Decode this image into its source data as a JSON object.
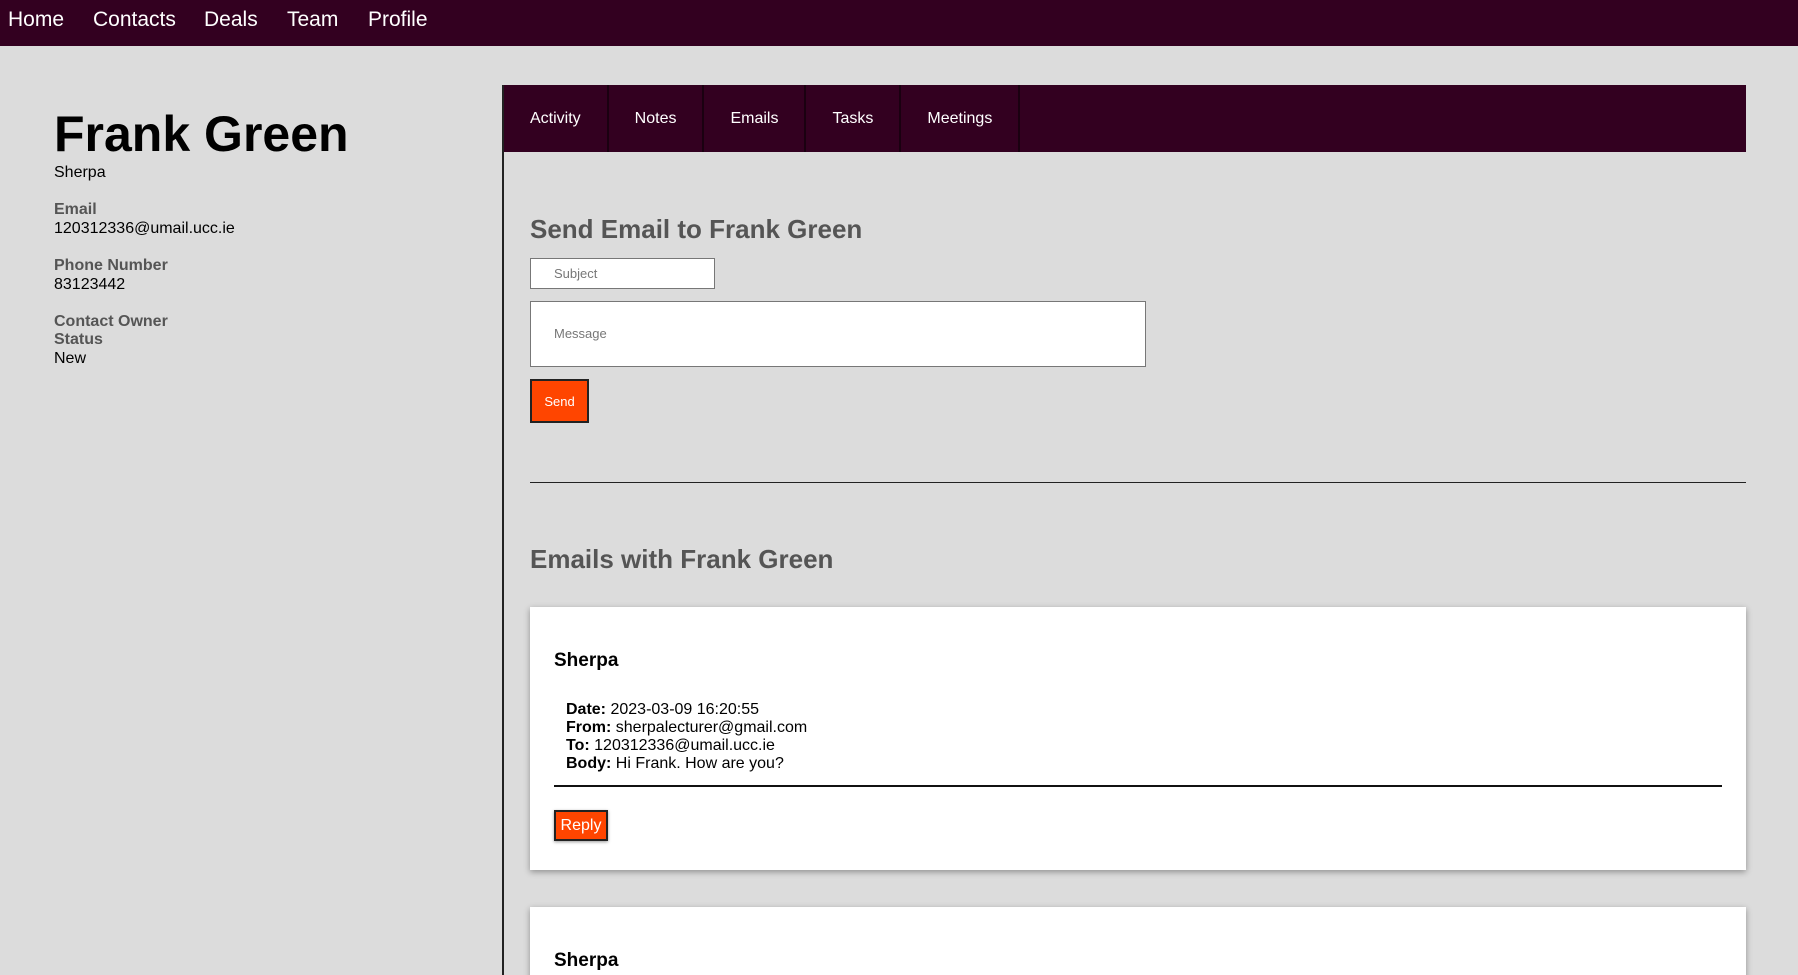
{
  "nav": {
    "items": [
      "Home",
      "Contacts",
      "Deals",
      "Team",
      "Profile"
    ]
  },
  "contact": {
    "name": "Frank Green",
    "company": "Sherpa",
    "fields": [
      {
        "label": "Email",
        "value": "120312336@umail.ucc.ie"
      },
      {
        "label": "Phone Number",
        "value": "83123442"
      },
      {
        "label": "Contact Owner",
        "value": ""
      },
      {
        "label": "Status",
        "value": "New"
      }
    ]
  },
  "tabs": [
    "Activity",
    "Notes",
    "Emails",
    "Tasks",
    "Meetings"
  ],
  "send_form": {
    "title": "Send Email to Frank Green",
    "subject_placeholder": "Subject",
    "message_placeholder": "Message",
    "send_label": "Send"
  },
  "emails_section": {
    "title": "Emails with Frank Green",
    "reply_label": "Reply",
    "labels": {
      "date": "Date:",
      "from": "From:",
      "to": "To:",
      "body": "Body:"
    },
    "emails": [
      {
        "sender": "Sherpa",
        "date": "2023-03-09 16:20:55",
        "from": "sherpalecturer@gmail.com",
        "to": "120312336@umail.ucc.ie",
        "body": "Hi Frank. How are you?"
      },
      {
        "sender": "Sherpa"
      }
    ]
  },
  "colors": {
    "nav_bg": "#330020",
    "page_bg": "#dcdcdc",
    "accent": "#ff4500"
  }
}
